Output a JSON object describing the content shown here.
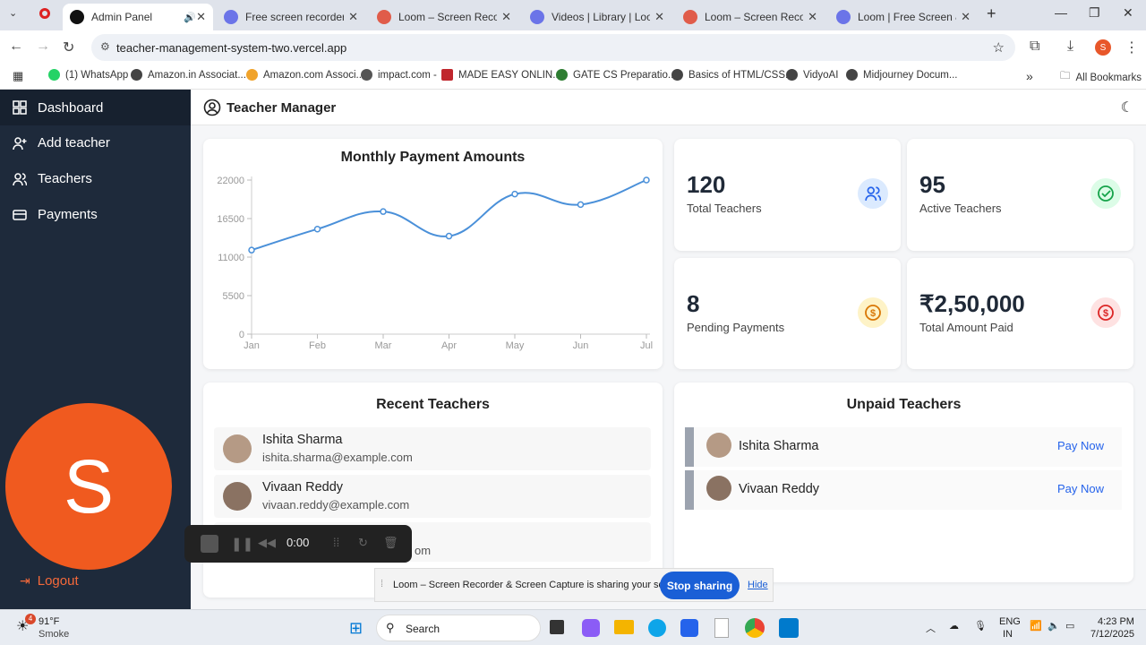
{
  "browser": {
    "tabs": [
      {
        "title": "Admin Panel",
        "color": "#111111"
      },
      {
        "title": "Free screen recorder for M",
        "color": "#6b74e8"
      },
      {
        "title": "Loom – Screen Recorder & S",
        "color": "#e05c4a"
      },
      {
        "title": "Videos | Library | Loom",
        "color": "#6b74e8"
      },
      {
        "title": "Loom – Screen Recorder & S",
        "color": "#e05c4a"
      },
      {
        "title": "Loom | Free Screen & Vide",
        "color": "#6b74e8"
      }
    ],
    "url": "teacher-management-system-two.vercel.app",
    "profile_letter": "S",
    "bookmarks": [
      {
        "label": "(1) WhatsApp",
        "color": "#25d366"
      },
      {
        "label": "Amazon.in Associat...",
        "color": "#444444"
      },
      {
        "label": "Amazon.com Associ...",
        "color": "#f0a32b"
      },
      {
        "label": "impact.com -",
        "color": "#555555"
      },
      {
        "label": "MADE EASY ONLIN...",
        "color": "#c0272d"
      },
      {
        "label": "GATE CS Preparatio...",
        "color": "#2e7d32"
      },
      {
        "label": "Basics of HTML/CSS...",
        "color": "#444444"
      },
      {
        "label": "VidyoAI",
        "color": "#444444"
      },
      {
        "label": "Midjourney Docum...",
        "color": "#444444"
      }
    ],
    "all_bookmarks": "All Bookmarks"
  },
  "sidebar": {
    "items": [
      "Dashboard",
      "Add teacher",
      "Teachers",
      "Payments"
    ],
    "avatar_letter": "S",
    "logout": "Logout"
  },
  "header": {
    "title": "Teacher Manager"
  },
  "chart_data": {
    "type": "line",
    "title": "Monthly Payment Amounts",
    "categories": [
      "Jan",
      "Feb",
      "Mar",
      "Apr",
      "May",
      "Jun",
      "Jul"
    ],
    "values": [
      12000,
      15000,
      17500,
      14000,
      20000,
      18500,
      22000
    ],
    "yticks": [
      0,
      5500,
      11000,
      16500,
      22000
    ],
    "ylim": [
      0,
      22000
    ],
    "color": "#4a90d9"
  },
  "stats": [
    {
      "value": "120",
      "label": "Total Teachers",
      "icon": "users-icon",
      "bg": "#dbeafe",
      "fg": "#2563eb"
    },
    {
      "value": "95",
      "label": "Active Teachers",
      "icon": "check-circle-icon",
      "bg": "#dcfce7",
      "fg": "#16a34a"
    },
    {
      "value": "8",
      "label": "Pending Payments",
      "icon": "coin-icon",
      "bg": "#fef3c7",
      "fg": "#d97706"
    },
    {
      "value": "₹2,50,000",
      "label": "Total Amount Paid",
      "icon": "rupee-icon",
      "bg": "#fee2e2",
      "fg": "#dc2626"
    }
  ],
  "recent": {
    "title": "Recent Teachers",
    "items": [
      {
        "name": "Ishita Sharma",
        "email": "ishita.sharma@example.com"
      },
      {
        "name": "Vivaan Reddy",
        "email": "vivaan.reddy@example.com"
      },
      {
        "name": "",
        "email": "om"
      }
    ]
  },
  "unpaid": {
    "title": "Unpaid Teachers",
    "items": [
      {
        "name": "Ishita Sharma",
        "action": "Pay Now"
      },
      {
        "name": "Vivaan Reddy",
        "action": "Pay Now"
      }
    ]
  },
  "recorder": {
    "time": "0:00"
  },
  "share": {
    "message": "Loom – Screen Recorder & Screen Capture is sharing your screen.",
    "stop": "Stop sharing",
    "hide": "Hide"
  },
  "taskbar": {
    "weather_temp": "91°F",
    "weather_desc": "Smoke",
    "search": "Search",
    "lang1": "ENG",
    "lang2": "IN",
    "time": "4:23 PM",
    "date": "7/12/2025",
    "badge": "4"
  }
}
